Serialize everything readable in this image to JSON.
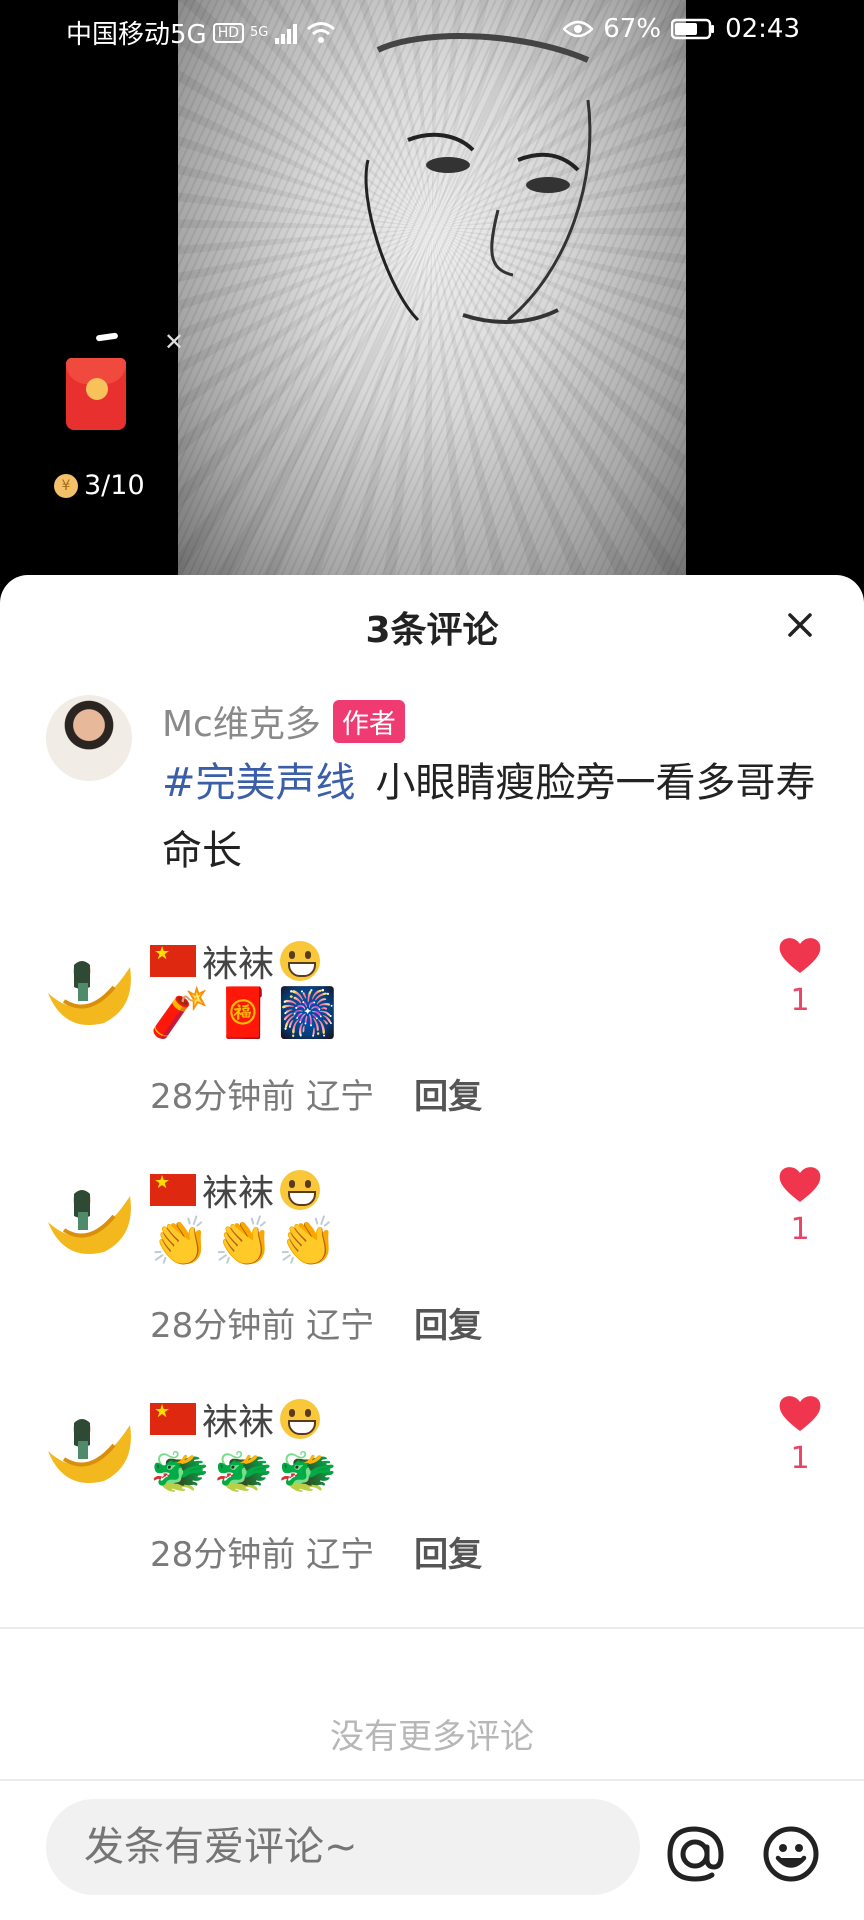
{
  "status_bar": {
    "carrier": "中国移动5G",
    "hd": "HD",
    "net": "5G",
    "battery": "67%",
    "time": "02:43"
  },
  "reward": {
    "count": "3/10",
    "coin_symbol": "¥"
  },
  "sheet": {
    "title": "3条评论",
    "author": {
      "name": "Mc维克多",
      "badge": "作者",
      "hashtag": "#完美声线",
      "text": "小眼睛瘦脸旁一看多哥寿命长"
    },
    "comments": [
      {
        "name": "袜袜",
        "body": "🧨🧧🎆",
        "time": "28分钟前",
        "location": "辽宁",
        "reply": "回复",
        "likes": "1"
      },
      {
        "name": "袜袜",
        "body": "👏👏👏",
        "time": "28分钟前",
        "location": "辽宁",
        "reply": "回复",
        "likes": "1"
      },
      {
        "name": "袜袜",
        "body": "🐲🐲🐲",
        "time": "28分钟前",
        "location": "辽宁",
        "reply": "回复",
        "likes": "1"
      }
    ],
    "no_more": "没有更多评论",
    "input_placeholder": "发条有爱评论~"
  },
  "colors": {
    "accent_red": "#ef3b72",
    "like_red": "#e94466",
    "hashtag_blue": "#3b5ea8"
  }
}
